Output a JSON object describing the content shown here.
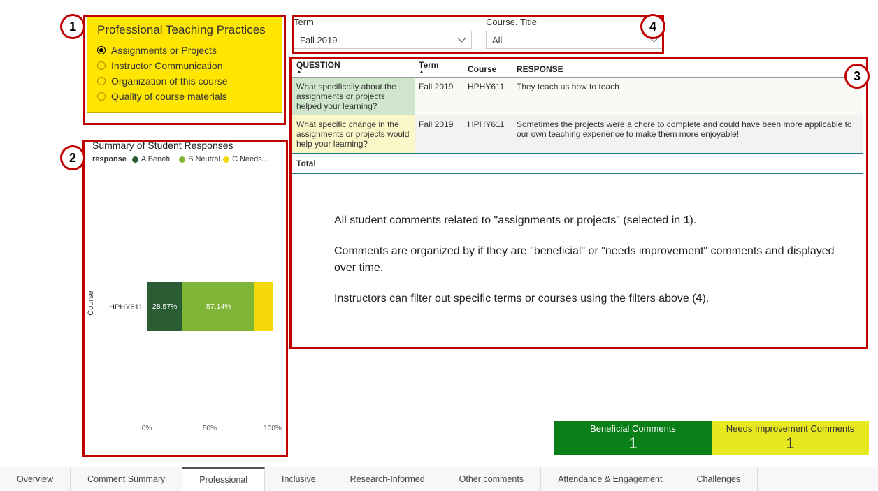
{
  "callouts": {
    "c1": "1",
    "c2": "2",
    "c3": "3",
    "c4": "4"
  },
  "ptp": {
    "title": "Professional Teaching Practices",
    "options": [
      "Assignments or Projects",
      "Instructor Communication",
      "Organization of this course",
      "Quality of course materials"
    ]
  },
  "chart": {
    "title": "Summary of Student Responses",
    "legend_label": "response",
    "series": [
      {
        "name": "A Benefi...",
        "color": "#2a5d33"
      },
      {
        "name": "B Neutral",
        "color": "#7fb637"
      },
      {
        "name": "C Needs...",
        "color": "#f5d80a"
      }
    ],
    "yaxis": "Course",
    "category": "HPHY611",
    "values_text": {
      "a": "28.57%",
      "b": "57.14%"
    },
    "ticks": {
      "t0": "0%",
      "t50": "50%",
      "t100": "100%"
    }
  },
  "chart_data": {
    "type": "bar",
    "orientation": "horizontal-stacked",
    "title": "Summary of Student Responses",
    "xlabel": "",
    "ylabel": "Course",
    "categories": [
      "HPHY611"
    ],
    "series": [
      {
        "name": "A Beneficial",
        "values": [
          28.57
        ],
        "color": "#2a5d33"
      },
      {
        "name": "B Neutral",
        "values": [
          57.14
        ],
        "color": "#7fb637"
      },
      {
        "name": "C Needs Improvement",
        "values": [
          14.29
        ],
        "color": "#f5d80a"
      }
    ],
    "xlim": [
      0,
      100
    ],
    "xticks": [
      0,
      50,
      100
    ]
  },
  "filters": {
    "term": {
      "label": "Term",
      "value": "Fall 2019"
    },
    "course": {
      "label": "Course. Title",
      "value": "All"
    }
  },
  "table": {
    "headers": {
      "q": "QUESTION",
      "term": "Term",
      "course": "Course",
      "resp": "RESPONSE"
    },
    "rows": [
      {
        "q": "What specifically about the assignments or projects helped your learning?",
        "term": "Fall 2019",
        "course": "HPHY611",
        "resp": "They teach us how to teach",
        "cls": "row-beneficial"
      },
      {
        "q": "What specific change in the assignments or projects would help your learning?",
        "term": "Fall 2019",
        "course": "HPHY611",
        "resp": "Sometimes the projects were a chore to complete and could have been more applicable to our own teaching experience to make them more enjoyable!",
        "cls": "row-needs"
      }
    ],
    "total": "Total"
  },
  "description": {
    "p1a": "All student comments related to \"assignments or projects\" (selected in ",
    "p1b": "1",
    "p1c": ").",
    "p2": "Comments are organized by if they are \"beneficial\" or \"needs improvement\" comments and displayed over time.",
    "p3a": "Instructors can filter out specific terms or courses using the filters above (",
    "p3b": "4",
    "p3c": ")."
  },
  "kpis": {
    "beneficial": {
      "label": "Beneficial Comments",
      "value": "1"
    },
    "needs": {
      "label": "Needs Improvement Comments",
      "value": "1"
    }
  },
  "tabs": [
    "Overview",
    "Comment Summary",
    "Professional",
    "Inclusive",
    "Research-Informed",
    "Other comments",
    "Attendance & Engagement",
    "Challenges"
  ],
  "active_tab": 2
}
